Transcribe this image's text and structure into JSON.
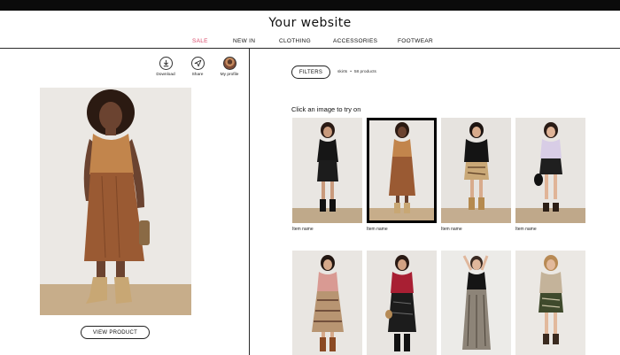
{
  "header": {
    "title": "Your website"
  },
  "nav": {
    "items": [
      {
        "label": "SALE",
        "accent": "#d94a6a"
      },
      {
        "label": "NEW IN"
      },
      {
        "label": "CLOTHING"
      },
      {
        "label": "ACCESSORIES"
      },
      {
        "label": "FOOTWEAR"
      }
    ]
  },
  "actions": {
    "download": "Download",
    "share": "Share",
    "profile": "My profile"
  },
  "hero": {
    "button": "VIEW PRODUCT"
  },
  "catalog": {
    "filters_label": "FILTERS",
    "breadcrumb_category": "skirts",
    "breadcrumb_separator": "•",
    "breadcrumb_count": "58 products",
    "heading": "Click an image to try on",
    "tiles": [
      {
        "item_name": "Item name",
        "selected": false
      },
      {
        "item_name": "Item name",
        "selected": true
      },
      {
        "item_name": "Item name",
        "selected": false
      },
      {
        "item_name": "Item name",
        "selected": false
      },
      {
        "item_name": "",
        "selected": false
      },
      {
        "item_name": "",
        "selected": false
      },
      {
        "item_name": "",
        "selected": false
      },
      {
        "item_name": "",
        "selected": false
      }
    ]
  }
}
